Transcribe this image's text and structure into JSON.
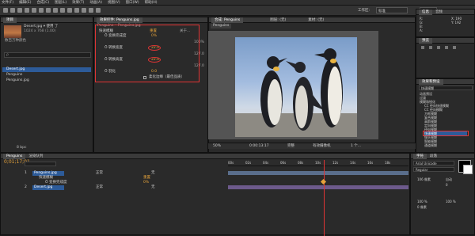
{
  "menu": [
    "文件(F)",
    "编辑(E)",
    "合成(C)",
    "图层(L)",
    "效果(T)",
    "动画(A)",
    "视图(V)",
    "窗口(W)",
    "帮助(H)"
  ],
  "toolbar": {
    "workspace_label": "工作区:",
    "workspace_value": "标准"
  },
  "project": {
    "tab": "项目",
    "item_name": "Desert.jpg ▾ 使用 了",
    "item_dims": "1024 x 768 (1.00)",
    "item_color": "数百万种颜色",
    "search_placeholder": "ρ",
    "files": [
      "Desert.jpg",
      "Penguins",
      "Penguins.jpg"
    ],
    "bpc": "8 bpc"
  },
  "effect_controls": {
    "tab": "效果控件: Penguins.jpg",
    "header": "Penguins • Penguins.jpg",
    "fx_name": "快速模糊",
    "reset": "重置",
    "about": "关于...",
    "rows": [
      {
        "label": "Ö 变换完成度",
        "value": "0%"
      },
      {
        "label": "",
        "value": "100%"
      },
      {
        "label": "Ö 转换宽度",
        "value": "22.0"
      },
      {
        "label": "",
        "value": "127.0"
      },
      {
        "label": "Ö 转换高度",
        "value": "22.0"
      },
      {
        "label": "",
        "value": "127.0"
      },
      {
        "label": "Ö 羽化",
        "value": "0.0"
      }
    ],
    "checkbox_label": "柔化边缘（最佳品质）"
  },
  "composition": {
    "tab": "合成: Penguins",
    "subtab": "Penguins",
    "layer_label": "图层: (无)",
    "footage_label": "素材: (无)",
    "zoom": "50%",
    "time": "0:00:13:17",
    "quality": "完整",
    "camera": "有效摄像机",
    "views": "1 个..."
  },
  "info": {
    "tab": "信息",
    "audio_tab": "音频",
    "r": "R:",
    "g": "G:",
    "b": "B:",
    "a": "A:",
    "x": "X: 190",
    "y": "Y: 192"
  },
  "preview_tab": "预览",
  "effects_presets": {
    "tab": "效果和预设",
    "search": "快速模糊",
    "items": [
      "动画预设",
      "过渡",
      "模糊和锐化",
      "CC 径向快速模糊",
      "CC 径向模糊",
      "方框模糊",
      "复合模糊",
      "高斯模糊",
      "定向模糊",
      "径向模糊",
      "快速模糊",
      "镜头模糊",
      "智能模糊",
      "通道模糊"
    ]
  },
  "timeline": {
    "tab": "Penguins",
    "render_tab": "渲染队列",
    "timecode": "0;01;17;01",
    "layers": [
      {
        "num": "1",
        "name": "Penguins.jpg",
        "mode": "正常",
        "parent": "无"
      },
      {
        "num": "",
        "name": "快速模糊",
        "mode": "",
        "parent": ""
      },
      {
        "num": "",
        "name": "Ö 变换完成度",
        "mode": "",
        "parent": ""
      },
      {
        "num": "2",
        "name": "Desert.jpg",
        "mode": "正常",
        "parent": "无"
      }
    ],
    "reset": "重置",
    "pct": "0%",
    "ruler": [
      "00s",
      "02s",
      "04s",
      "06s",
      "08s",
      "10s",
      "12s",
      "14s",
      "16s",
      "18s",
      "20s"
    ]
  },
  "character": {
    "tab": "字符",
    "para_tab": "段落",
    "font": "Arial Unicode",
    "style": "Regular",
    "size": "106 像素",
    "leading": "自动",
    "tracking": "0",
    "scale_v": "100 %",
    "scale_h": "100 %",
    "baseline": "0 像素"
  },
  "colors": {
    "accent_red": "#e03434",
    "selection": "#2d5b99",
    "orange": "#e7a33a"
  }
}
